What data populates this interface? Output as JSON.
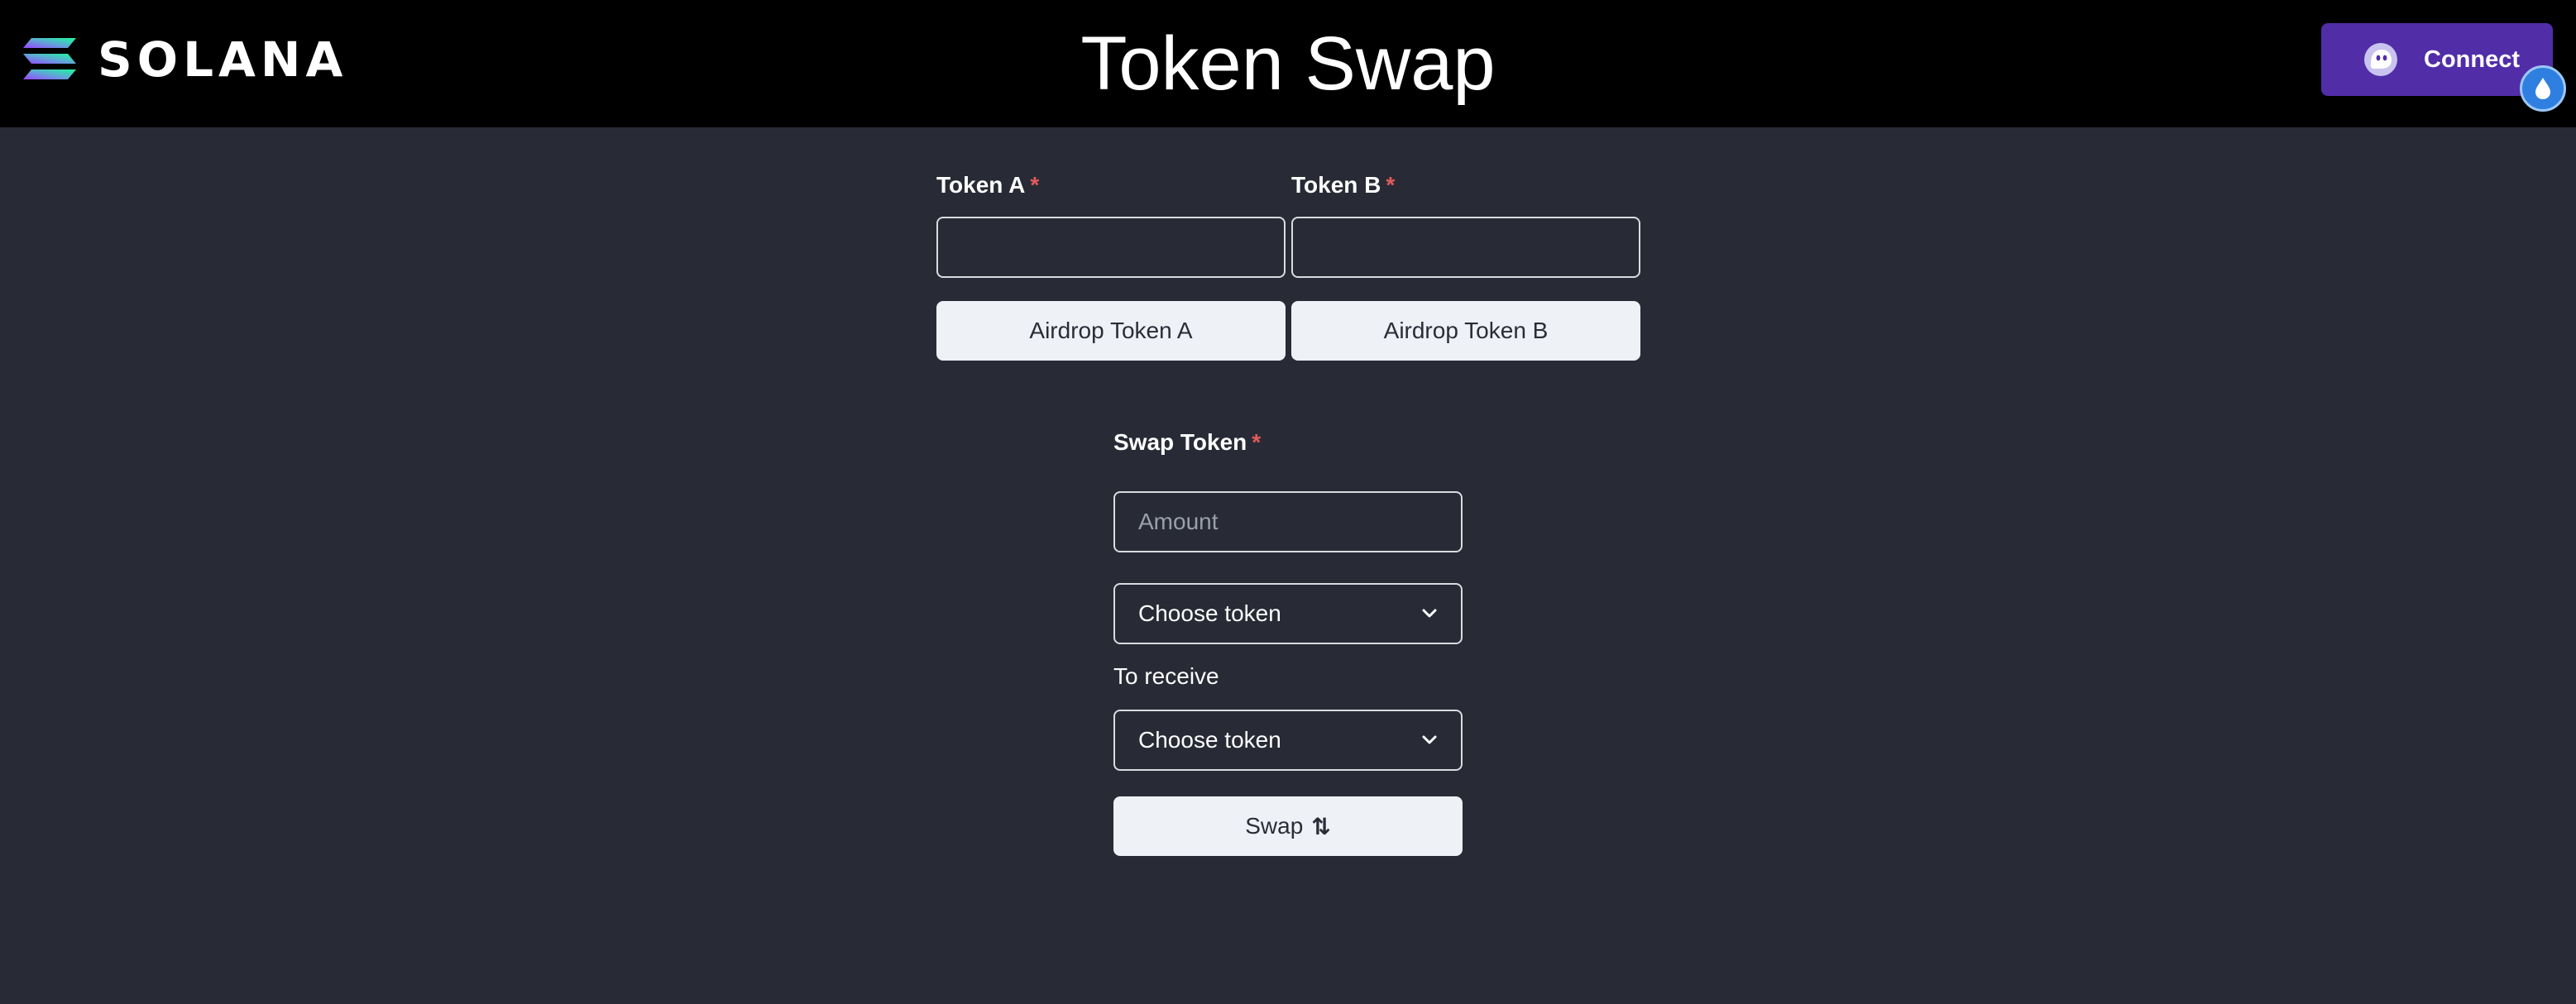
{
  "header": {
    "logo_text": "SOLANA",
    "title": "Token Swap",
    "connect_label": "Connect"
  },
  "token_inputs": {
    "token_a_label": "Token A",
    "token_b_label": "Token B",
    "required_mark": "*",
    "token_a_value": "",
    "token_b_value": "",
    "airdrop_a_label": "Airdrop Token A",
    "airdrop_b_label": "Airdrop Token B"
  },
  "swap": {
    "section_label": "Swap Token",
    "required_mark": "*",
    "amount_placeholder": "Amount",
    "amount_value": "",
    "from_select": "Choose token",
    "to_receive_label": "To receive",
    "to_select": "Choose token",
    "swap_label": "Swap",
    "swap_icon": "⇅"
  },
  "colors": {
    "background": "#282b35",
    "header": "#000000",
    "connect_button": "#512da8",
    "required": "#e25b5b",
    "button": "#eef1f6"
  },
  "icons": [
    "solana-logo-icon",
    "ghost-wallet-icon",
    "droplet-icon",
    "chevron-down-icon",
    "swap-arrows-icon"
  ]
}
